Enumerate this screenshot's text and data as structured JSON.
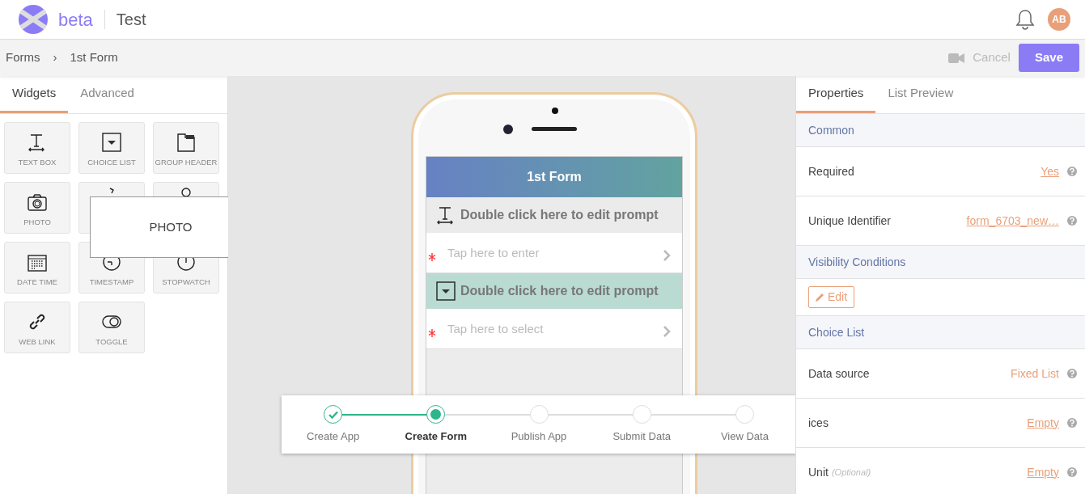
{
  "header": {
    "brand": "beta",
    "app_title": "Test",
    "avatar": "AB"
  },
  "breadcrumb": {
    "items": [
      "Forms",
      "1st Form"
    ],
    "separator": "›"
  },
  "toolbar": {
    "cancel": "Cancel",
    "save": "Save"
  },
  "left_tabs": [
    {
      "label": "Widgets",
      "selected": true
    },
    {
      "label": "Advanced",
      "selected": false
    }
  ],
  "widgets": [
    {
      "kind": "textbox",
      "label": "TEXT BOX"
    },
    {
      "kind": "choice",
      "label": "CHOICE LIST"
    },
    {
      "kind": "group",
      "label": "GROUP HEADER"
    },
    {
      "kind": "photo",
      "label": "PHOTO"
    },
    {
      "kind": "signature"
    },
    {
      "kind": "location"
    },
    {
      "kind": "datetime",
      "label": "DATE TIME"
    },
    {
      "kind": "timestamp",
      "label": "TIMESTAMP"
    },
    {
      "kind": "stopwatch",
      "label": "STOPWATCH"
    },
    {
      "kind": "link",
      "label": "WEB LINK"
    },
    {
      "kind": "toggle",
      "label": "TOGGLE"
    }
  ],
  "tooltip": "PHOTO",
  "form": {
    "title": "1st Form",
    "fields": [
      {
        "kind": "textbox",
        "prompt": "Double click here to edit prompt",
        "placeholder": "Tap here to enter",
        "required": true,
        "selected": false
      },
      {
        "kind": "choice",
        "prompt": "Double click here to edit prompt",
        "placeholder": "Tap here to select",
        "required": true,
        "selected": true
      }
    ]
  },
  "steps": [
    {
      "label": "Create App",
      "completed": true,
      "selected": false
    },
    {
      "label": "Create Form",
      "completed": false,
      "selected": true
    },
    {
      "label": "Publish App",
      "completed": false,
      "selected": false
    },
    {
      "label": "Submit Data",
      "completed": false,
      "selected": false
    },
    {
      "label": "View Data",
      "completed": false,
      "selected": false
    }
  ],
  "right_tabs": [
    {
      "label": "Properties",
      "selected": true
    },
    {
      "label": "List Preview",
      "selected": false
    }
  ],
  "sections": [
    {
      "title": "Common",
      "rows": [
        {
          "kind": "property",
          "label": "Required",
          "value": "Yes",
          "link": true
        },
        {
          "kind": "property",
          "label": "Unique Identifier",
          "value": "form_6703_new…",
          "link": true
        }
      ]
    },
    {
      "title": "Visibility Conditions",
      "rows": [
        {
          "kind": "button",
          "label": "Edit"
        }
      ]
    },
    {
      "title": "Choice List",
      "rows": [
        {
          "kind": "property",
          "label": "Data source",
          "value": "Fixed List",
          "link": false
        },
        {
          "kind": "property",
          "label": "ices",
          "value": "Empty",
          "link": true
        },
        {
          "kind": "property",
          "label": "Unit",
          "note": "(Optional)",
          "value": "Empty",
          "link": true
        }
      ]
    }
  ]
}
